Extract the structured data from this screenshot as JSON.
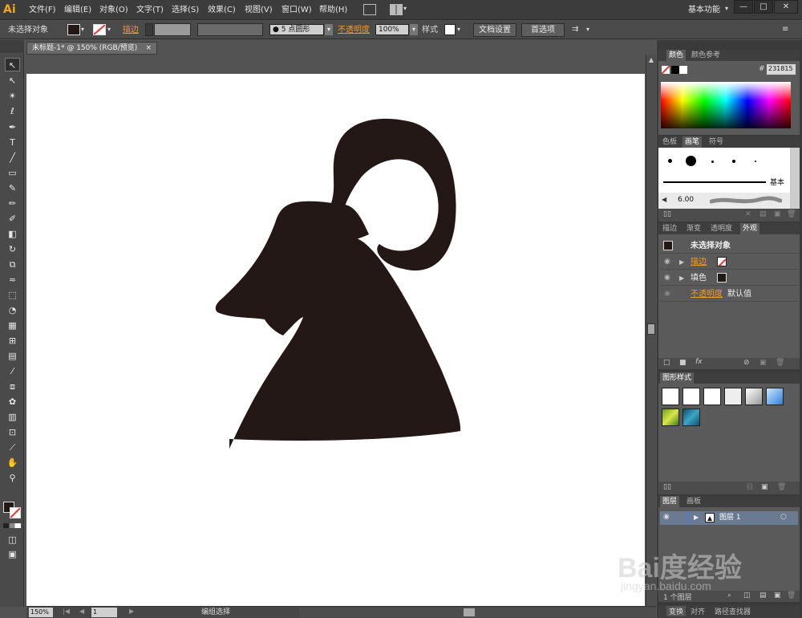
{
  "app": {
    "logo": "Ai"
  },
  "menu": {
    "items": [
      "文件(F)",
      "编辑(E)",
      "对象(O)",
      "文字(T)",
      "选择(S)",
      "效果(C)",
      "视图(V)",
      "窗口(W)",
      "帮助(H)"
    ],
    "workspace": "基本功能",
    "window_controls": [
      "—",
      "□",
      "✕"
    ]
  },
  "control_bar": {
    "selection_state": "未选择对象",
    "stroke_label": "描边",
    "brush_size": "5",
    "brush_shape": "点圆形",
    "opacity_label": "不透明度",
    "opacity_value": "100%",
    "style_label": "样式",
    "doc_setup": "文档设置",
    "preferences": "首选项"
  },
  "document": {
    "tab_title": "未标题-1* @ 150% (RGB/预览)",
    "tab_close": "×",
    "artwork_color": "#231815",
    "canvas_background": "#ffffff"
  },
  "status_bar": {
    "zoom": "150%",
    "artboard": "1",
    "status_text": "编组选择"
  },
  "color_panel": {
    "tabs": [
      "颜色",
      "颜色参考"
    ],
    "hex_label": "#",
    "hex_value": "231815"
  },
  "brush_panel": {
    "tabs": [
      "色板",
      "画笔",
      "符号"
    ],
    "basic_label": "基本",
    "size_label": "6.00"
  },
  "appearance_panel": {
    "tabs": [
      "描边",
      "渐变",
      "透明度",
      "外观"
    ],
    "title": "未选择对象",
    "stroke_label": "描边",
    "fill_label": "填色",
    "opacity_label": "不透明度",
    "opacity_value": "默认值",
    "fx_label": "fx"
  },
  "graphic_styles_panel": {
    "tabs": [
      "图形样式"
    ]
  },
  "layers_panel": {
    "tabs": [
      "图层",
      "画板"
    ],
    "layer_name": "图层 1",
    "layer_count": "1 个图层"
  },
  "bottom_tabs": [
    "变换",
    "对齐",
    "路径查找器"
  ],
  "watermark": {
    "brand": "Bai度经验",
    "url": "jingyan.baidu.com"
  }
}
